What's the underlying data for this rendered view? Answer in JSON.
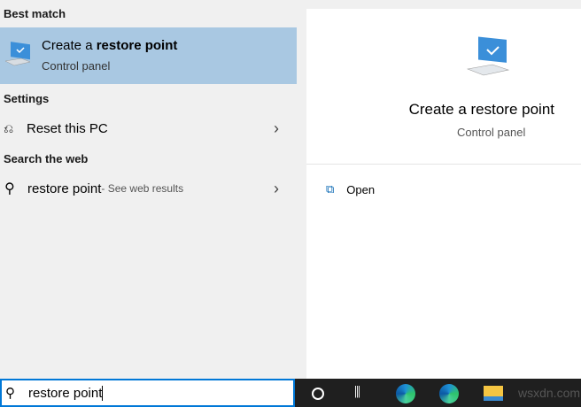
{
  "left": {
    "best_match_header": "Best match",
    "best_match": {
      "title_prefix": "Create a ",
      "title_bold": "restore point",
      "subtitle": "Control panel"
    },
    "settings_header": "Settings",
    "settings_item": "Reset this PC",
    "web_header": "Search the web",
    "web_item": {
      "query": "restore point",
      "suffix": " - See web results"
    }
  },
  "right": {
    "title": "Create a restore point",
    "subtitle": "Control panel",
    "actions": [
      {
        "label": "Open"
      }
    ]
  },
  "search": {
    "value": "restore point"
  },
  "watermark": "wsxdn.com",
  "colors": {
    "highlight": "#a9c8e2",
    "taskbar": "#1f1f1f",
    "accent": "#0078d7"
  }
}
